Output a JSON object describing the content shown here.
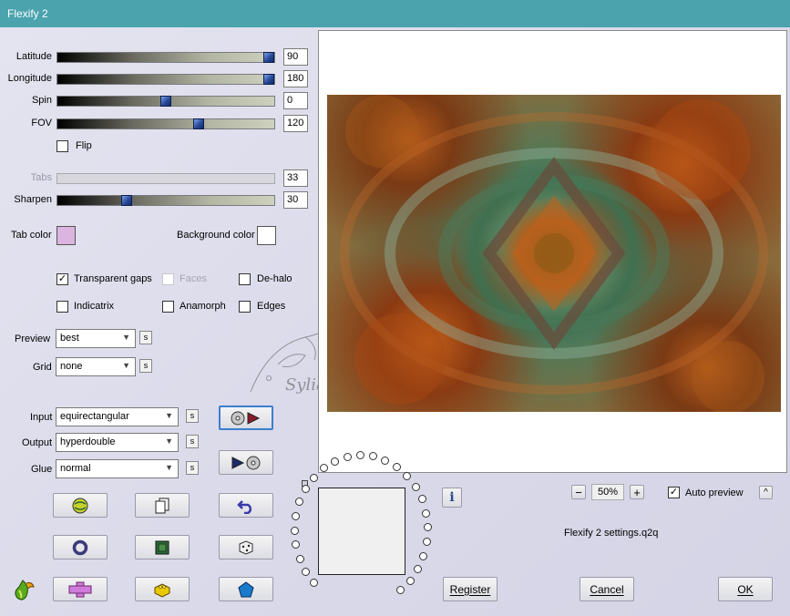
{
  "window": {
    "title": "Flexify 2"
  },
  "sliders": [
    {
      "label": "Latitude",
      "value": "90",
      "fraction": 1.0,
      "enabled": true
    },
    {
      "label": "Longitude",
      "value": "180",
      "fraction": 1.0,
      "enabled": true
    },
    {
      "label": "Spin",
      "value": "0",
      "fraction": 0.5,
      "enabled": true
    },
    {
      "label": "FOV",
      "value": "120",
      "fraction": 0.66,
      "enabled": true
    },
    {
      "label": "Tabs",
      "value": "33",
      "fraction": 0,
      "enabled": false
    },
    {
      "label": "Sharpen",
      "value": "30",
      "fraction": 0.31,
      "enabled": true
    }
  ],
  "flip": {
    "label": "Flip",
    "checked": false
  },
  "colors": {
    "tab_label": "Tab color",
    "tab_value": "#dcb4e0",
    "bg_label": "Background color",
    "bg_value": "#ffffff"
  },
  "options": {
    "transparent_gaps": {
      "label": "Transparent gaps",
      "checked": true
    },
    "faces": {
      "label": "Faces",
      "checked": false,
      "enabled": false
    },
    "dehalo": {
      "label": "De-halo",
      "checked": false
    },
    "indicatrix": {
      "label": "Indicatrix",
      "checked": false
    },
    "anamorph": {
      "label": "Anamorph",
      "checked": false
    },
    "edges": {
      "label": "Edges",
      "checked": false
    }
  },
  "preview": {
    "label": "Preview",
    "value": "best"
  },
  "grid": {
    "label": "Grid",
    "value": "none"
  },
  "input": {
    "label": "Input",
    "value": "equirectangular"
  },
  "output": {
    "label": "Output",
    "value": "hyperdouble"
  },
  "glue": {
    "label": "Glue",
    "value": "normal"
  },
  "small_button": "s",
  "zoom": {
    "minus": "−",
    "value": "50%",
    "plus": "+"
  },
  "auto_preview": {
    "label": "Auto preview",
    "checked": true
  },
  "settings_file": "Flexify 2 settings.q2q",
  "buttons": {
    "register": "Register",
    "cancel": "Cancel",
    "ok": "OK",
    "info": "i",
    "collapse": "^"
  },
  "watermark_text": "Syliane",
  "accent": "#4aa3ad"
}
